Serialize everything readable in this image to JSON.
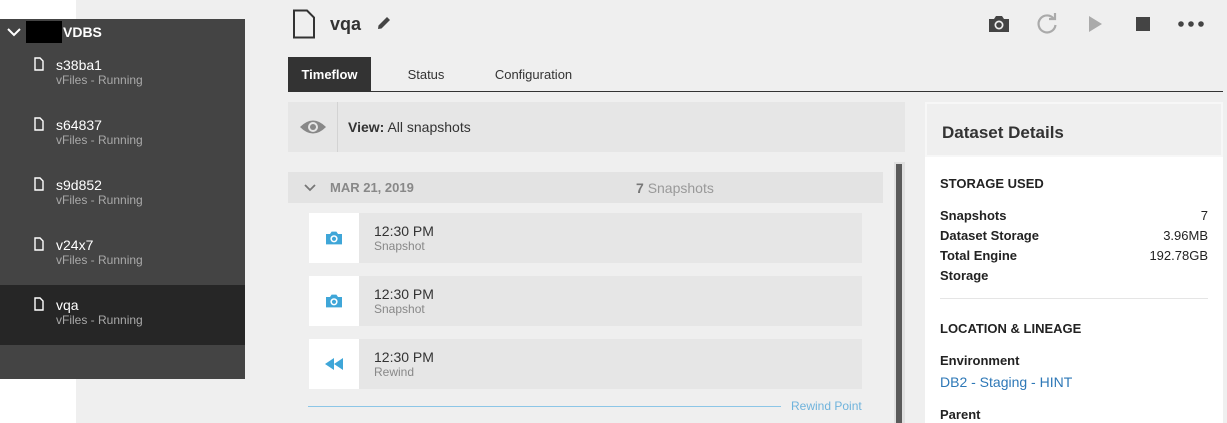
{
  "sidebar": {
    "title": "VDBS",
    "items": [
      {
        "name": "s38ba1",
        "status": "vFiles - Running"
      },
      {
        "name": "s64837",
        "status": "vFiles - Running"
      },
      {
        "name": "s9d852",
        "status": "vFiles - Running"
      },
      {
        "name": "v24x7",
        "status": "vFiles - Running"
      },
      {
        "name": "vqa",
        "status": "vFiles - Running",
        "active": true
      }
    ]
  },
  "header": {
    "title": "vqa",
    "actions": [
      "camera-icon",
      "refresh-icon",
      "play-icon",
      "stop-icon",
      "more-icon"
    ]
  },
  "tabs": [
    "Timeflow",
    "Status",
    "Configuration"
  ],
  "view": {
    "label": "View:",
    "value": "All snapshots"
  },
  "timeline": {
    "date": "MAR 21, 2019",
    "count": "7",
    "count_label": "Snapshots",
    "events": [
      {
        "time": "12:30 PM",
        "type": "Snapshot",
        "icon": "camera-icon"
      },
      {
        "time": "12:30 PM",
        "type": "Snapshot",
        "icon": "camera-icon"
      },
      {
        "time": "12:30 PM",
        "type": "Rewind",
        "icon": "rewind-icon"
      }
    ],
    "rewind_point": "Rewind Point"
  },
  "details": {
    "title": "Dataset Details",
    "storage": {
      "heading": "STORAGE USED",
      "rows": [
        {
          "key": "Snapshots",
          "value": "7"
        },
        {
          "key": "Dataset Storage",
          "value": "3.96MB"
        },
        {
          "key": "Total Engine Storage",
          "value": "192.78GB"
        }
      ]
    },
    "location": {
      "heading": "LOCATION & LINEAGE",
      "env_label": "Environment",
      "env_value": "DB2 - Staging - HINT",
      "parent_label": "Parent"
    }
  },
  "colors": {
    "accent": "#3fa6d8",
    "link": "#2e78b7",
    "sidebar": "#444444",
    "sidebar_active": "#262626"
  }
}
